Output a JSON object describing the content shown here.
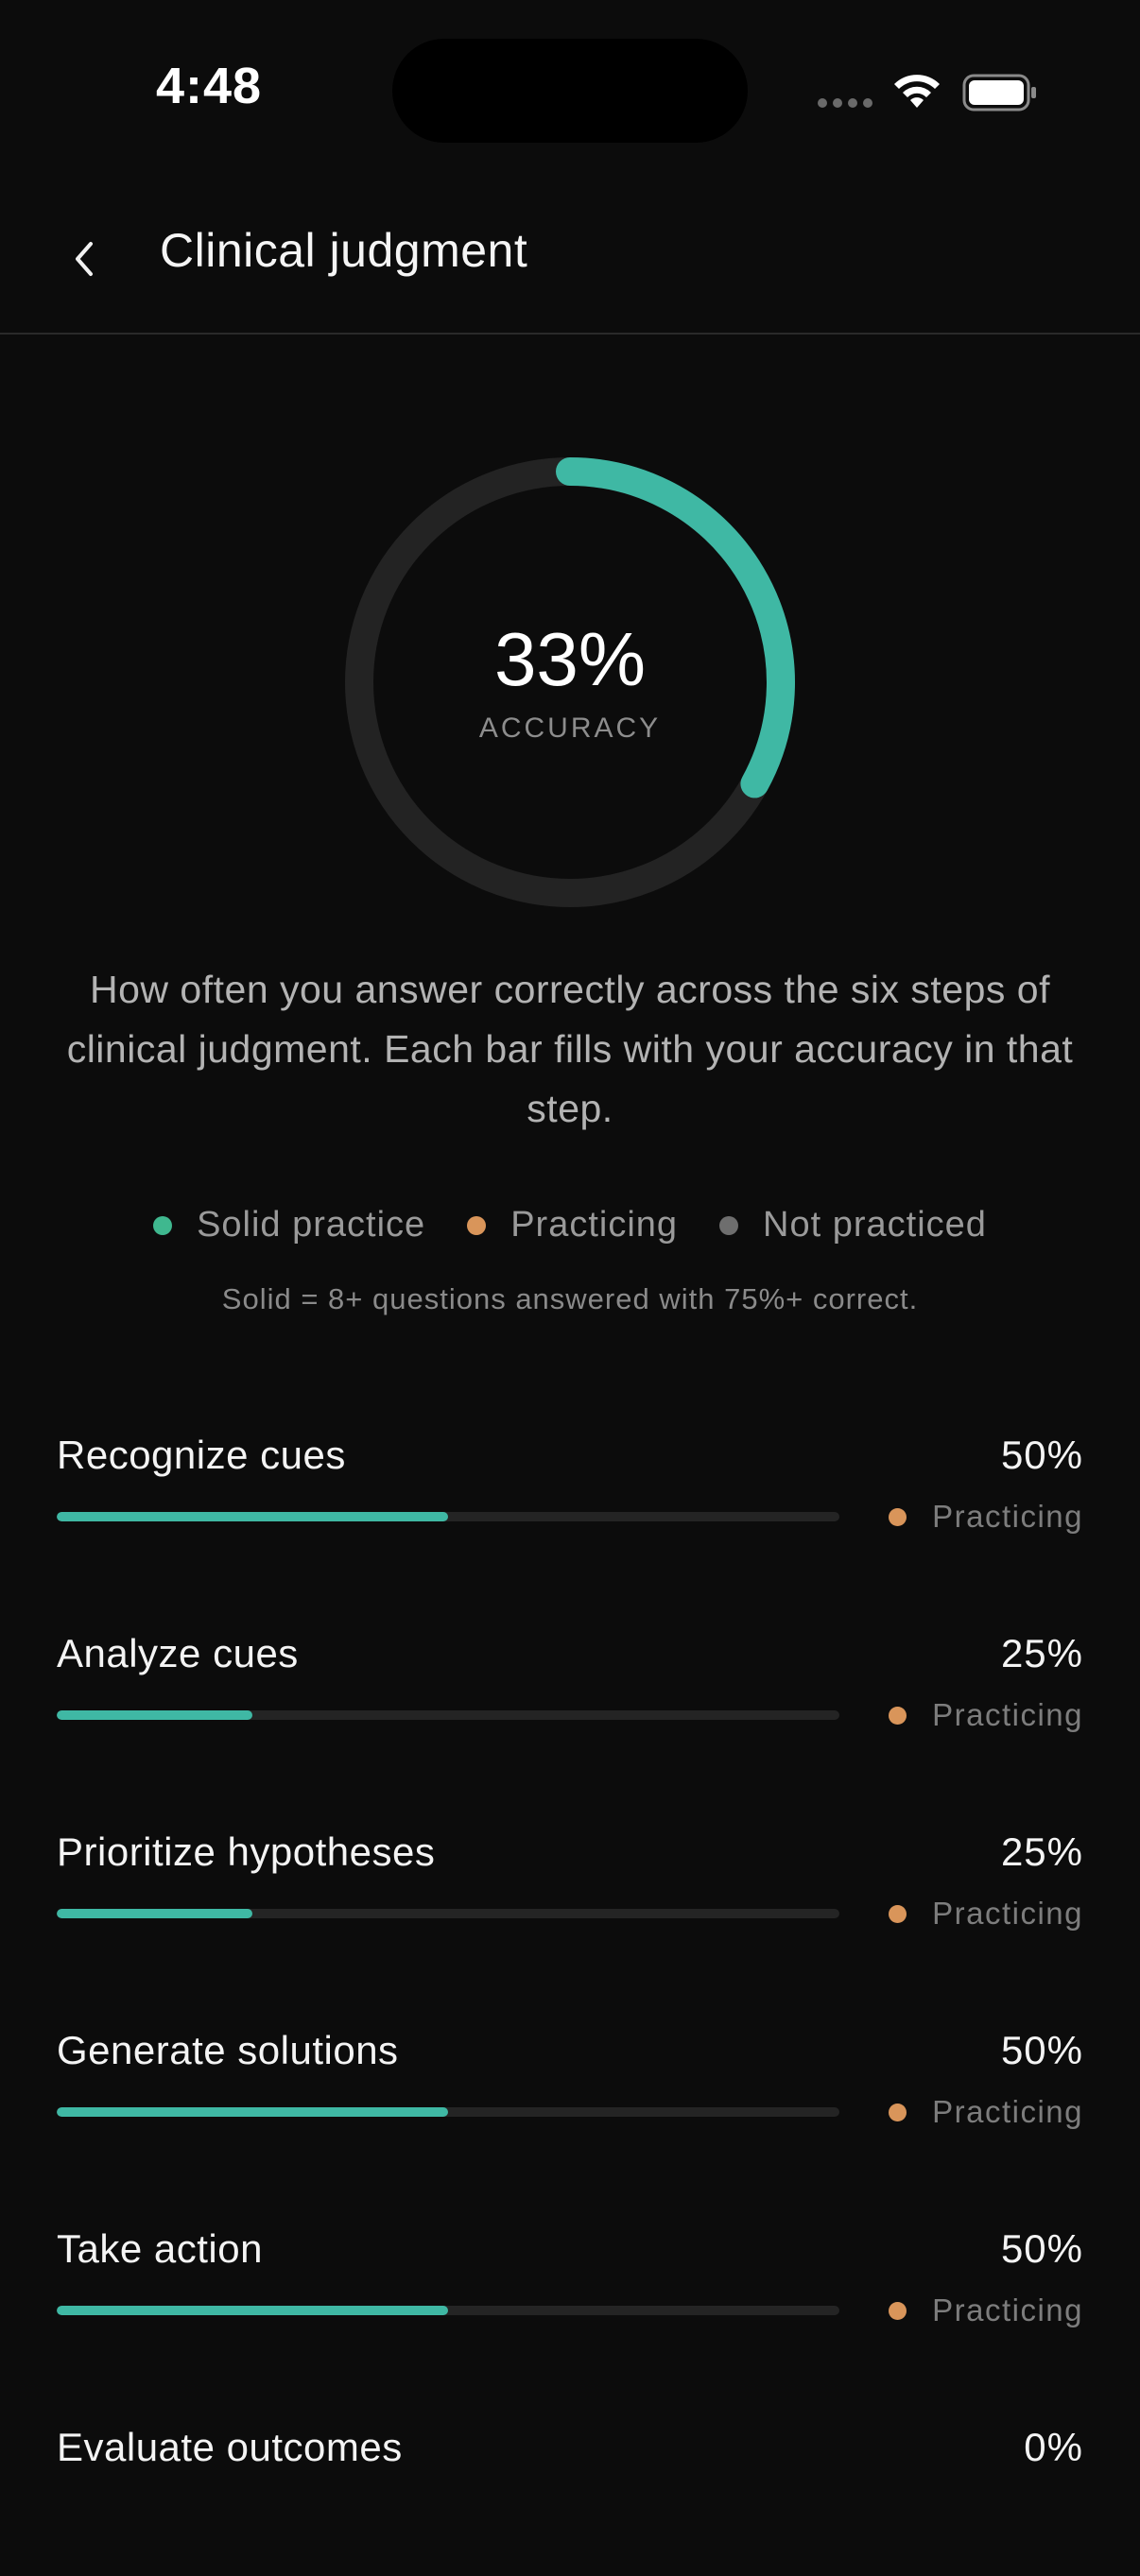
{
  "status_bar": {
    "time": "4:48",
    "icons": [
      "cellular-signal-icon",
      "wifi-icon",
      "battery-icon"
    ]
  },
  "header": {
    "back_icon": "chevron-left-icon",
    "title": "Clinical judgment"
  },
  "accuracy": {
    "value_text": "33%",
    "fraction": 0.33,
    "label": "ACCURACY"
  },
  "description": "How often you answer correctly across the six steps of clinical judgment. Each bar fills with your accuracy in that step.",
  "legend": {
    "items": [
      {
        "label": "Solid practice",
        "color": "#3fb88f"
      },
      {
        "label": "Practicing",
        "color": "#d9955a"
      },
      {
        "label": "Not practiced",
        "color": "#6e6e6e"
      }
    ],
    "note": "Solid = 8+ questions answered with 75%+ correct."
  },
  "colors": {
    "accent": "#3fb8a4",
    "track": "#242424",
    "background": "#0c0c0c",
    "practicing": "#d9955a"
  },
  "steps": [
    {
      "name": "Recognize cues",
      "percent_text": "50%",
      "fraction": 0.5,
      "status": "Practicing"
    },
    {
      "name": "Analyze cues",
      "percent_text": "25%",
      "fraction": 0.25,
      "status": "Practicing"
    },
    {
      "name": "Prioritize hypotheses",
      "percent_text": "25%",
      "fraction": 0.25,
      "status": "Practicing"
    },
    {
      "name": "Generate solutions",
      "percent_text": "50%",
      "fraction": 0.5,
      "status": "Practicing"
    },
    {
      "name": "Take action",
      "percent_text": "50%",
      "fraction": 0.5,
      "status": "Practicing"
    },
    {
      "name": "Evaluate outcomes",
      "percent_text": "0%",
      "fraction": 0,
      "status": ""
    }
  ]
}
